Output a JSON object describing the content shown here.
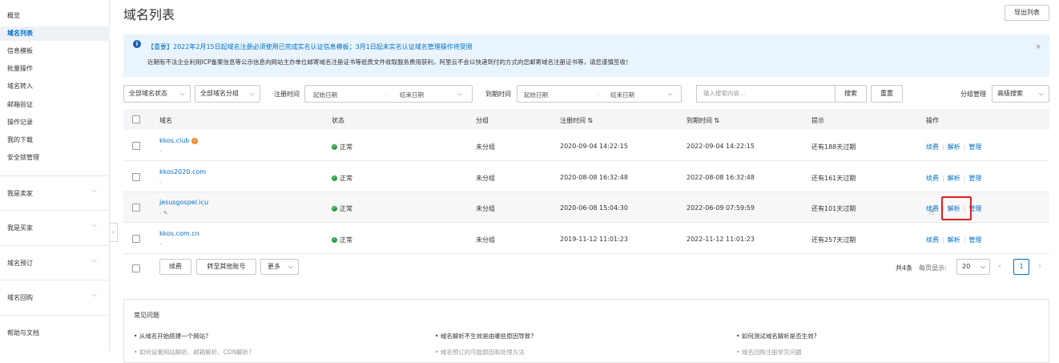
{
  "sidebar": {
    "items": [
      "概览",
      "域名列表",
      "信息模板",
      "批量操作",
      "域名转入",
      "邮箱验证",
      "操作记录",
      "我的下载",
      "安全锁管理"
    ],
    "groups": [
      "我是卖家",
      "我是买家",
      "域名预订",
      "域名回购"
    ],
    "help": "帮助与文档"
  },
  "header": {
    "title": "域名列表",
    "export_label": "导出列表"
  },
  "notice": {
    "line1": "【重要】2022年2月15日起域名注册必须使用已完成实名认证信息模板；3月1日起未实名认证域名管理操作将受限",
    "line2": "近期有不法企业利用ICP备案信息等公示信息向网站主办单位邮寄域名注册证书等纸质文件收取服务费用获利，阿里云不会以快递到付的方式向您邮寄域名注册证书等，请您谨慎签收！",
    "close": "×"
  },
  "filters": {
    "status": "全部域名状态",
    "group": "全部域名分组",
    "reg_time_label": "注册时间",
    "reg_start": "起始日期",
    "reg_end": "结束日期",
    "exp_time_label": "到期时间",
    "exp_start": "起始日期",
    "exp_end": "结束日期",
    "search_placeholder": "输入搜索内容...",
    "search_btn": "搜索",
    "reset_btn": "重置",
    "group_manage": "分组管理",
    "advanced": "高级搜索"
  },
  "table": {
    "headers": {
      "domain": "域名",
      "status": "状态",
      "group": "分组",
      "reg": "注册时间 ⇅",
      "exp": "到期时间 ⇅",
      "tip": "提示",
      "ops": "操作"
    },
    "rows": [
      {
        "domain": "kkos.club",
        "sub": "-",
        "status": "正常",
        "group": "未分组",
        "reg": "2020-09-04 14:22:15",
        "exp": "2022-09-04 14:22:15",
        "tip": "还有188天过期"
      },
      {
        "domain": "kkos2020.com",
        "sub": "-",
        "status": "正常",
        "group": "未分组",
        "reg": "2020-08-08 16:32:48",
        "exp": "2022-08-08 16:32:48",
        "tip": "还有161天过期"
      },
      {
        "domain": "jesusgospel.icu",
        "sub": "- ✎",
        "status": "正常",
        "group": "未分组",
        "reg": "2020-06-08 15:04:30",
        "exp": "2022-06-09 07:59:59",
        "tip": "还有101天过期"
      },
      {
        "domain": "kkos.com.cn",
        "sub": "-",
        "status": "正常",
        "group": "未分组",
        "reg": "2019-11-12 11:01:23",
        "exp": "2022-11-12 11:01:23",
        "tip": "还有257天过期"
      }
    ],
    "ops": {
      "renew": "续费",
      "resolve": "解析",
      "manage": "管理"
    }
  },
  "footer": {
    "renew": "续费",
    "transfer": "转至其他账号",
    "more": "更多",
    "total": "共4条",
    "per_page_label": "每页显示:",
    "per_page": "20",
    "page": "1"
  },
  "faq": {
    "title": "常见问题",
    "q1": "• 从域名开始搭建一个网站?",
    "q2": "• 域名解析不生效是由哪些原因导致?",
    "q3": "• 如何测试域名解析是否生效?",
    "q4": "• 如何设置网站解析、邮箱解析、CDN解析?",
    "q5": "• 域名预订的可能原因和处理方法",
    "q6": "• 域名回购注册常见问题"
  },
  "colors": {
    "accent": "#0070cc",
    "highlight": "#e02020",
    "ok": "#27a048"
  }
}
